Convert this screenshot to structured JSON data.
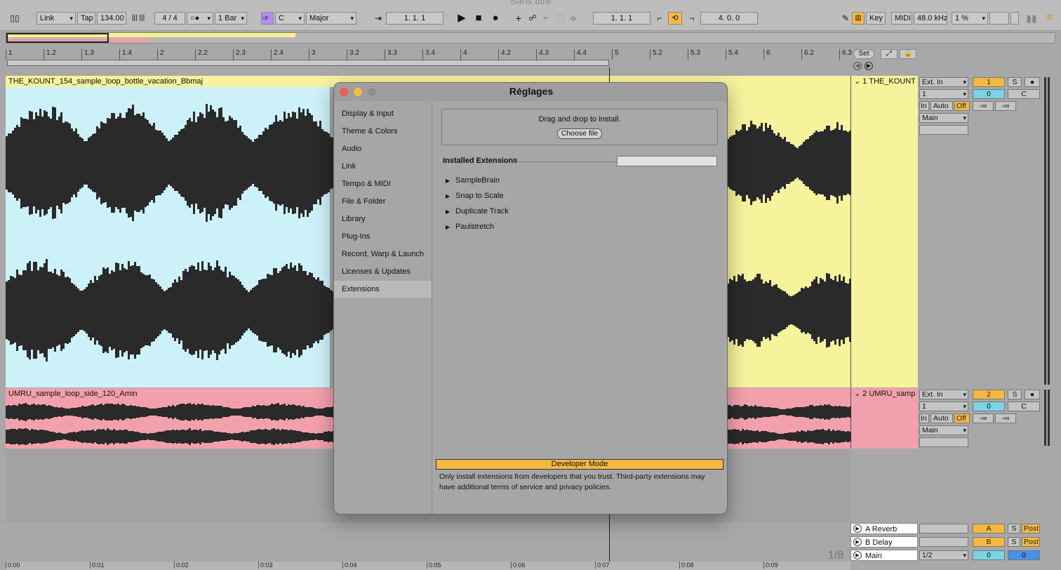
{
  "window": {
    "title": "Sans titre"
  },
  "toolbar": {
    "link": "Link",
    "tap": "Tap",
    "tempo": "134.00",
    "time_signature": "4 / 4",
    "metronome": "○●",
    "quantize": "1 Bar",
    "scale_icon": "♭♯",
    "key": "C",
    "scale": "Major",
    "position": "1.   1.   1",
    "loop_start": "1.   1.   1",
    "loop_length": "4.   0.   0",
    "key_label": "Key",
    "midi_label": "MIDI",
    "sample_rate": "48.0 kHz",
    "cpu": "1 %"
  },
  "ruler": {
    "bars": [
      "1",
      "1.2",
      "1.3",
      "1.4",
      "2",
      "2.2",
      "2.3",
      "2.4",
      "3",
      "3.2",
      "3.3",
      "3.4",
      "4",
      "4.2",
      "4.3",
      "4.4",
      "5",
      "5.2",
      "5.3",
      "5.4",
      "6",
      "6.2",
      "6.3"
    ],
    "set_label": "Set"
  },
  "tracks": [
    {
      "clip_name": "THE_KOUNT_154_sample_loop_bottle_vacation_Bbmaj",
      "strip_name": "1 THE_KOUNT",
      "input": "Ext. In",
      "channel": "1",
      "number": "1",
      "volume": "0",
      "pan": "C",
      "monitor_in": "In",
      "monitor_auto": "Auto",
      "monitor_off": "Off",
      "output": "Main",
      "peak_l": "-∞",
      "peak_r": "-∞",
      "solo": "S"
    },
    {
      "clip_name": "UMRU_sample_loop_side_120_Amin",
      "strip_name": "2 UMRU_samp",
      "input": "Ext. In",
      "channel": "1",
      "number": "2",
      "volume": "0",
      "pan": "C",
      "monitor_in": "In",
      "monitor_auto": "Auto",
      "monitor_off": "Off",
      "output": "Main",
      "peak_l": "-∞",
      "peak_r": "-∞",
      "solo": "S"
    }
  ],
  "returns": [
    {
      "name": "A Reverb",
      "letter": "A",
      "solo": "S",
      "post": "Post"
    },
    {
      "name": "B Delay",
      "letter": "B",
      "solo": "S",
      "post": "Post"
    }
  ],
  "main": {
    "name": "Main",
    "ratio": "1/2",
    "vol_a": "0",
    "vol_b": "0"
  },
  "timeline": {
    "marks": [
      "0:00",
      "0:01",
      "0:02",
      "0:03",
      "0:04",
      "0:05",
      "0:06",
      "0:07",
      "0:08",
      "0:09"
    ],
    "zoom_indicator": "1/8"
  },
  "settings": {
    "title": "Réglages",
    "sections": [
      "Display & Input",
      "Theme & Colors",
      "Audio",
      "Link",
      "Tempo & MIDI",
      "File & Folder",
      "Library",
      "Plug-Ins",
      "Record, Warp & Launch",
      "Licenses & Updates",
      "Extensions"
    ],
    "selected": "Extensions",
    "drop_text": "Drag and drop to install.",
    "choose_file": "Choose file",
    "installed_label": "Installed Extensions",
    "extensions": [
      "SampleBrain",
      "Snap to Scale",
      "Duplicate Track",
      "Paulstretch"
    ],
    "developer_mode": "Developer Mode",
    "developer_note": "Only install extensions from developers that you trust. Third-party extensions may have additional terms of service and privacy policies."
  },
  "colors": {
    "accent": "#f5b942",
    "clip1": "#f7f29c",
    "clip1_sel": "#cdf1f8",
    "clip2": "#f2a0ac"
  }
}
